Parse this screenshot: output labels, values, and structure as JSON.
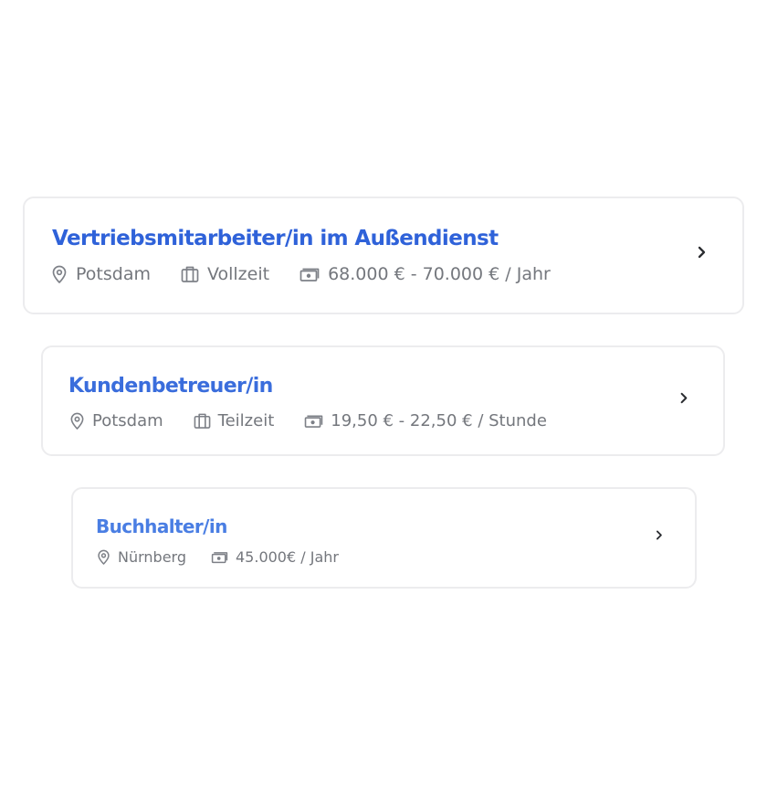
{
  "colors": {
    "title_1": "#2f62d9",
    "title_2": "#3a6ddc",
    "title_3": "#4a7ee3",
    "meta_text": "#74777d",
    "icon": "#7d8087",
    "chevron": "#2b2d31",
    "card_border": "#ececee"
  },
  "icons": {
    "location": "location-pin-icon",
    "job_type": "briefcase-icon",
    "salary": "banknote-icon",
    "open": "chevron-right-icon"
  },
  "jobs": [
    {
      "title": "Vertriebsmitarbeiter/in im Außendienst",
      "location": "Potsdam",
      "type": "Vollzeit",
      "salary": "68.000 € - 70.000 € / Jahr"
    },
    {
      "title": "Kundenbetreuer/in",
      "location": "Potsdam",
      "type": "Teilzeit",
      "salary": "19,50 € - 22,50 € / Stunde"
    },
    {
      "title": "Buchhalter/in",
      "location": "Nürnberg",
      "salary": "45.000€ / Jahr"
    }
  ]
}
